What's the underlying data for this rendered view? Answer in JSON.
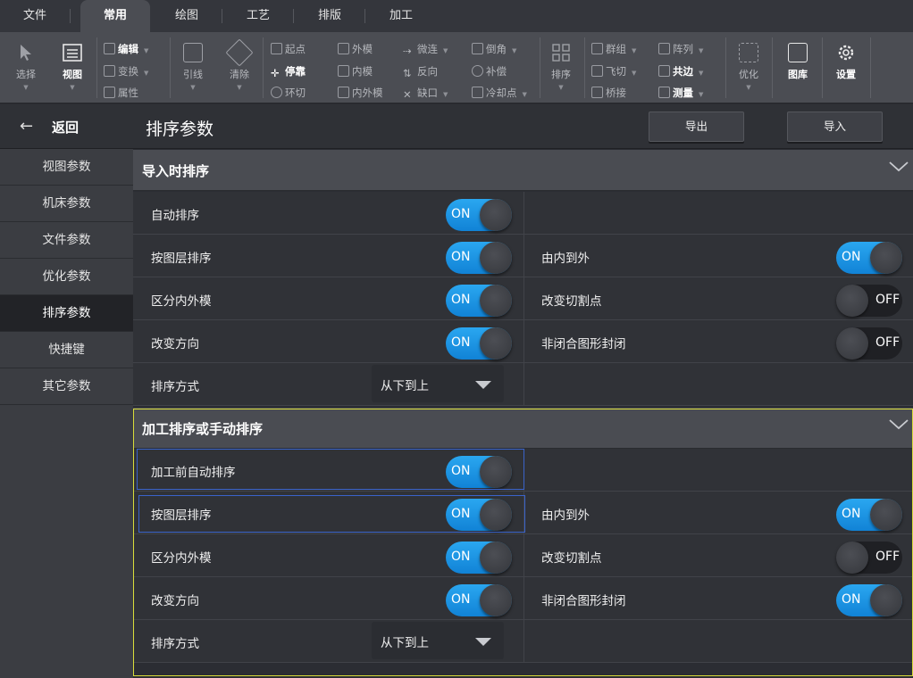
{
  "menu": {
    "tabs": [
      "文件",
      "常用",
      "绘图",
      "工艺",
      "排版",
      "加工"
    ],
    "active": 1
  },
  "ribbon": {
    "select": "选择",
    "view": "视图",
    "edit": "编辑",
    "transform": "变换",
    "property": "属性",
    "lead": "引线",
    "clear": "清除",
    "start": "起点",
    "dock": "停靠",
    "loop_cut": "环切",
    "outer": "外模",
    "inner": "内模",
    "in_out": "内外模",
    "micro": "微连",
    "reverse": "反向",
    "gap": "缺口",
    "chamfer": "倒角",
    "compensate": "补偿",
    "cooling": "冷却点",
    "sort": "排序",
    "group": "群组",
    "fly_cut": "飞切",
    "bridge": "桥接",
    "array": "阵列",
    "common_edge": "共边",
    "measure": "测量",
    "optimize": "优化",
    "library": "图库",
    "settings": "设置"
  },
  "sidebar": {
    "back_label": "返回",
    "items": [
      "视图参数",
      "机床参数",
      "文件参数",
      "优化参数",
      "排序参数",
      "快捷键",
      "其它参数"
    ],
    "active": 4
  },
  "header": {
    "title": "排序参数",
    "export_label": "导出",
    "import_label": "导入"
  },
  "section1": {
    "title": "导入时排序",
    "auto_sort": {
      "label": "自动排序",
      "state": "ON"
    },
    "by_layer": {
      "label": "按图层排序",
      "state": "ON"
    },
    "inside_out": {
      "label": "由内到外",
      "state": "ON"
    },
    "distinguish": {
      "label": "区分内外模",
      "state": "ON"
    },
    "change_cut_point": {
      "label": "改变切割点",
      "state": "OFF"
    },
    "change_direction": {
      "label": "改变方向",
      "state": "ON"
    },
    "close_open": {
      "label": "非闭合图形封闭",
      "state": "OFF"
    },
    "method": {
      "label": "排序方式",
      "value": "从下到上"
    }
  },
  "section2": {
    "title": "加工排序或手动排序",
    "auto_before": {
      "label": "加工前自动排序",
      "state": "ON"
    },
    "by_layer": {
      "label": "按图层排序",
      "state": "ON"
    },
    "inside_out": {
      "label": "由内到外",
      "state": "ON"
    },
    "distinguish": {
      "label": "区分内外模",
      "state": "ON"
    },
    "change_cut_point": {
      "label": "改变切割点",
      "state": "OFF"
    },
    "change_direction": {
      "label": "改变方向",
      "state": "ON"
    },
    "close_open": {
      "label": "非闭合图形封闭",
      "state": "ON"
    },
    "method": {
      "label": "排序方式",
      "value": "从下到上"
    }
  },
  "colors": {
    "accent": "#1e97e8",
    "highlight_box": "#d8dc3a",
    "focus_box": "#3a63c9"
  }
}
